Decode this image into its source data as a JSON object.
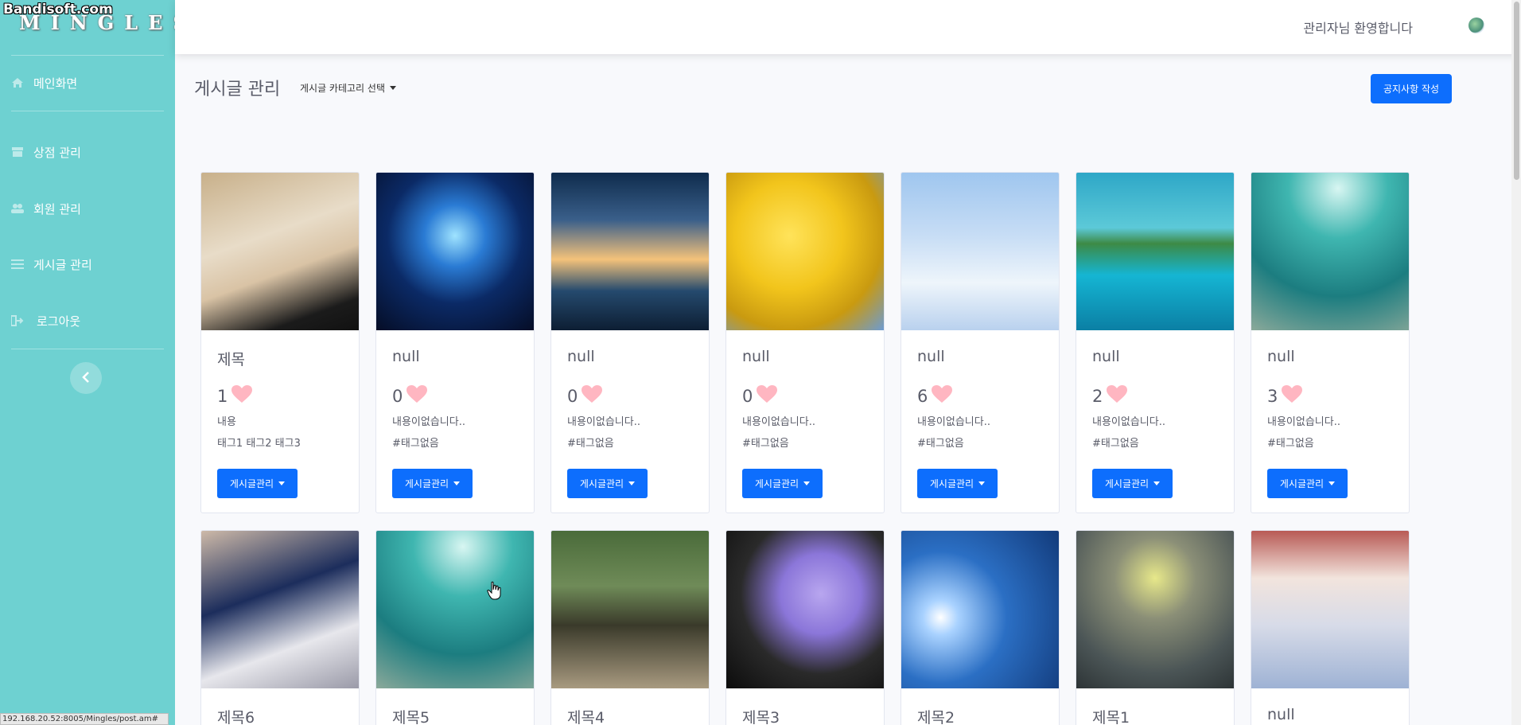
{
  "watermark": "Bandisoft.com",
  "brand": "MINGLES",
  "sidebar": {
    "items": [
      {
        "label": "메인화면",
        "icon": "home-icon"
      },
      {
        "label": "상점 관리",
        "icon": "store-icon"
      },
      {
        "label": "회원 관리",
        "icon": "users-icon"
      },
      {
        "label": "게시글 관리",
        "icon": "list-icon"
      },
      {
        "label": "로그아웃",
        "icon": "sign-out-icon"
      }
    ],
    "toggle_icon": "chevron-left-icon"
  },
  "topbar": {
    "welcome": "관리자님 환영합니다",
    "avatar_icon": "avatar-icon"
  },
  "header": {
    "title": "게시글 관리",
    "category_select": "게시글 카테고리 선택",
    "notice_button": "공지사항 작성"
  },
  "cards": [
    {
      "title": "제목",
      "likes": "1",
      "content": "내용",
      "tags": "태그1 태그2 태그3",
      "button": "게시글관리",
      "image": "portrait-man"
    },
    {
      "title": "null",
      "likes": "0",
      "content": "내용이없습니다..",
      "tags": "#태그없음",
      "button": "게시글관리",
      "image": "cosmic-portal"
    },
    {
      "title": "null",
      "likes": "0",
      "content": "내용이없습니다..",
      "tags": "#태그없음",
      "button": "게시글관리",
      "image": "space-sunset"
    },
    {
      "title": "null",
      "likes": "0",
      "content": "내용이없습니다..",
      "tags": "#태그없음",
      "button": "게시글관리",
      "image": "yellow-tree"
    },
    {
      "title": "null",
      "likes": "6",
      "content": "내용이없습니다..",
      "tags": "#태그없음",
      "button": "게시글관리",
      "image": "rainbow-clouds"
    },
    {
      "title": "null",
      "likes": "2",
      "content": "내용이없습니다..",
      "tags": "#태그없음",
      "button": "게시글관리",
      "image": "floating-island"
    },
    {
      "title": "null",
      "likes": "3",
      "content": "내용이없습니다..",
      "tags": "#태그없음",
      "button": "게시글관리",
      "image": "underwater-light"
    },
    {
      "title": "제목6",
      "image": "soccer-player"
    },
    {
      "title": "제목5",
      "image": "underwater-light"
    },
    {
      "title": "제목4",
      "image": "forest-path"
    },
    {
      "title": "제목3",
      "image": "hyacinth-flowers"
    },
    {
      "title": "제목2",
      "image": "dandelions-sky"
    },
    {
      "title": "제목1",
      "image": "rainy-flower"
    },
    {
      "title": "null",
      "image": "girl-group"
    }
  ],
  "status_url": "192.168.20.52:8005/Mingles/post.am#",
  "colors": {
    "sidebar": "#6ed1d1",
    "primary": "#0d6efd",
    "heart": "#ffb6c1"
  }
}
